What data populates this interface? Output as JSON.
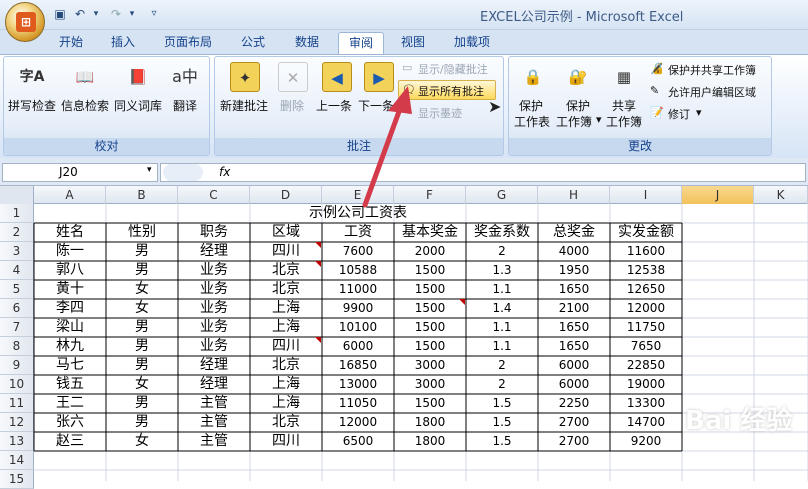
{
  "window": {
    "title": "EXCEL公司示例 - Microsoft Excel"
  },
  "qa_icons": [
    "save-icon",
    "undo-icon",
    "redo-icon",
    "customize-icon"
  ],
  "tabs": [
    "开始",
    "插入",
    "页面布局",
    "公式",
    "数据",
    "审阅",
    "视图",
    "加载项"
  ],
  "active_tab": "审阅",
  "ribbon": {
    "proofing": {
      "label": "校对",
      "buttons": [
        "拼写检查",
        "信息检索",
        "同义词库",
        "翻译"
      ]
    },
    "comments": {
      "label": "批注",
      "new": "新建批注",
      "delete": "删除",
      "prev": "上一条",
      "next": "下一条",
      "show_hide": "显示/隐藏批注",
      "show_all": "显示所有批注",
      "show_ink": "显示墨迹"
    },
    "changes": {
      "label": "更改",
      "protect_sheet": [
        "保护",
        "工作表"
      ],
      "protect_book": [
        "保护",
        "工作簿"
      ],
      "share": [
        "共享",
        "工作簿"
      ],
      "protect_share": "保护并共享工作簿",
      "allow_edit": "允许用户编辑区域",
      "track": "修订"
    }
  },
  "formula_bar": {
    "name_box": "J20",
    "fx": "fx",
    "value": ""
  },
  "columns": [
    "A",
    "B",
    "C",
    "D",
    "E",
    "F",
    "G",
    "H",
    "I",
    "J",
    "K"
  ],
  "rows": [
    "1",
    "2",
    "3",
    "4",
    "5",
    "6",
    "7",
    "8",
    "9",
    "10",
    "11",
    "12",
    "13",
    "14",
    "15"
  ],
  "sheet": {
    "title": "示例公司工资表",
    "headers": [
      "姓名",
      "性别",
      "职务",
      "区域",
      "工资",
      "基本奖金",
      "奖金系数",
      "总奖金",
      "实发金额"
    ],
    "data": [
      [
        "陈一",
        "男",
        "经理",
        "四川",
        "7600",
        "2000",
        "2",
        "4000",
        "11600"
      ],
      [
        "郭八",
        "男",
        "业务",
        "北京",
        "10588",
        "1500",
        "1.3",
        "1950",
        "12538"
      ],
      [
        "黄十",
        "女",
        "业务",
        "北京",
        "11000",
        "1500",
        "1.1",
        "1650",
        "12650"
      ],
      [
        "李四",
        "女",
        "业务",
        "上海",
        "9900",
        "1500",
        "1.4",
        "2100",
        "12000"
      ],
      [
        "梁山",
        "男",
        "业务",
        "上海",
        "10100",
        "1500",
        "1.1",
        "1650",
        "11750"
      ],
      [
        "林九",
        "男",
        "业务",
        "四川",
        "6000",
        "1500",
        "1.1",
        "1650",
        "7650"
      ],
      [
        "马七",
        "男",
        "经理",
        "北京",
        "16850",
        "3000",
        "2",
        "6000",
        "22850"
      ],
      [
        "钱五",
        "女",
        "经理",
        "上海",
        "13000",
        "3000",
        "2",
        "6000",
        "19000"
      ],
      [
        "王二",
        "男",
        "主管",
        "上海",
        "11050",
        "1500",
        "1.5",
        "2250",
        "13300"
      ],
      [
        "张六",
        "男",
        "主管",
        "北京",
        "12000",
        "1800",
        "1.5",
        "2700",
        "14700"
      ],
      [
        "赵三",
        "女",
        "主管",
        "四川",
        "6500",
        "1800",
        "1.5",
        "2700",
        "9200"
      ]
    ]
  },
  "colors": {
    "arrow": "#d33a4a",
    "comment_marker": "#c00000",
    "active_tab": "#ffffff",
    "ribbon": "#dbe7f6"
  },
  "watermark": "Bai 经验"
}
